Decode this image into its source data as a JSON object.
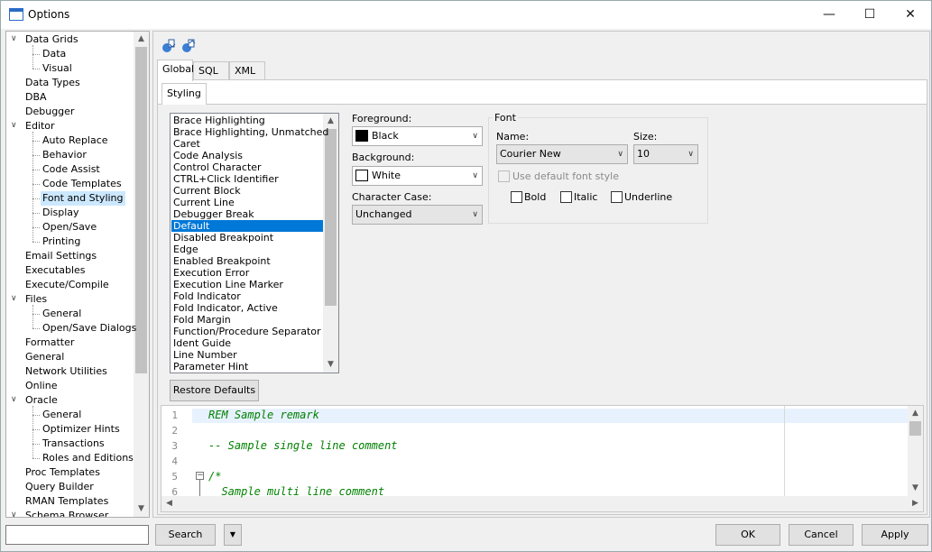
{
  "window": {
    "title": "Options",
    "minimize": "—",
    "maximize": "☐",
    "close": "✕"
  },
  "tree": {
    "items": [
      {
        "label": "Data Grids",
        "level": 0,
        "expander": "∨"
      },
      {
        "label": "Data",
        "level": 1
      },
      {
        "label": "Visual",
        "level": 1
      },
      {
        "label": "Data Types",
        "level": 0
      },
      {
        "label": "DBA",
        "level": 0
      },
      {
        "label": "Debugger",
        "level": 0
      },
      {
        "label": "Editor",
        "level": 0,
        "expander": "∨"
      },
      {
        "label": "Auto Replace",
        "level": 1
      },
      {
        "label": "Behavior",
        "level": 1
      },
      {
        "label": "Code Assist",
        "level": 1
      },
      {
        "label": "Code Templates",
        "level": 1
      },
      {
        "label": "Font and Styling",
        "level": 1,
        "selected": true
      },
      {
        "label": "Display",
        "level": 1
      },
      {
        "label": "Open/Save",
        "level": 1
      },
      {
        "label": "Printing",
        "level": 1
      },
      {
        "label": "Email Settings",
        "level": 0
      },
      {
        "label": "Executables",
        "level": 0
      },
      {
        "label": "Execute/Compile",
        "level": 0
      },
      {
        "label": "Files",
        "level": 0,
        "expander": "∨"
      },
      {
        "label": "General",
        "level": 1
      },
      {
        "label": "Open/Save Dialogs",
        "level": 1
      },
      {
        "label": "Formatter",
        "level": 0
      },
      {
        "label": "General",
        "level": 0
      },
      {
        "label": "Network Utilities",
        "level": 0
      },
      {
        "label": "Online",
        "level": 0
      },
      {
        "label": "Oracle",
        "level": 0,
        "expander": "∨"
      },
      {
        "label": "General",
        "level": 1
      },
      {
        "label": "Optimizer Hints",
        "level": 1
      },
      {
        "label": "Transactions",
        "level": 1
      },
      {
        "label": "Roles and Editions",
        "level": 1
      },
      {
        "label": "Proc Templates",
        "level": 0
      },
      {
        "label": "Query Builder",
        "level": 0
      },
      {
        "label": "RMAN Templates",
        "level": 0
      },
      {
        "label": "Schema Browser",
        "level": 0,
        "expander": "∨"
      }
    ]
  },
  "toolbar": {
    "icons": [
      "import-settings-icon",
      "export-settings-icon"
    ]
  },
  "tabs": [
    "Global",
    "SQL",
    "XML"
  ],
  "active_tab": "Global",
  "subtab": "Styling",
  "styles_list": [
    "Brace Highlighting",
    "Brace Highlighting, Unmatched",
    "Caret",
    "Code Analysis",
    "Control Character",
    "CTRL+Click Identifier",
    "Current Block",
    "Current Line",
    "Debugger Break",
    "Default",
    "Disabled Breakpoint",
    "Edge",
    "Enabled Breakpoint",
    "Execution Error",
    "Execution Line Marker",
    "Fold Indicator",
    "Fold Indicator, Active",
    "Fold Margin",
    "Function/Procedure Separator",
    "Ident Guide",
    "Line Number",
    "Parameter Hint"
  ],
  "selected_style": "Default",
  "foreground": {
    "label": "Foreground:",
    "value": "Black",
    "color": "#000000"
  },
  "background": {
    "label": "Background:",
    "value": "White",
    "color": "#ffffff"
  },
  "character_case": {
    "label": "Character Case:",
    "value": "Unchanged"
  },
  "font": {
    "group_label": "Font",
    "name_label": "Name:",
    "name_value": "Courier New",
    "size_label": "Size:",
    "size_value": "10",
    "use_default_label": "Use default font style",
    "bold_label": "Bold",
    "italic_label": "Italic",
    "underline_label": "Underline"
  },
  "restore_defaults": "Restore Defaults",
  "editor": {
    "lines": [
      {
        "n": "1",
        "text": "REM Sample remark"
      },
      {
        "n": "2",
        "text": ""
      },
      {
        "n": "3",
        "text": "-- Sample single line comment"
      },
      {
        "n": "4",
        "text": ""
      },
      {
        "n": "5",
        "text": "/*"
      },
      {
        "n": "6",
        "text": "  Sample multi line comment"
      }
    ],
    "comment_color": "#008000"
  },
  "bottom": {
    "search": "Search",
    "dropdown": "▼",
    "ok": "OK",
    "cancel": "Cancel",
    "apply": "Apply"
  }
}
